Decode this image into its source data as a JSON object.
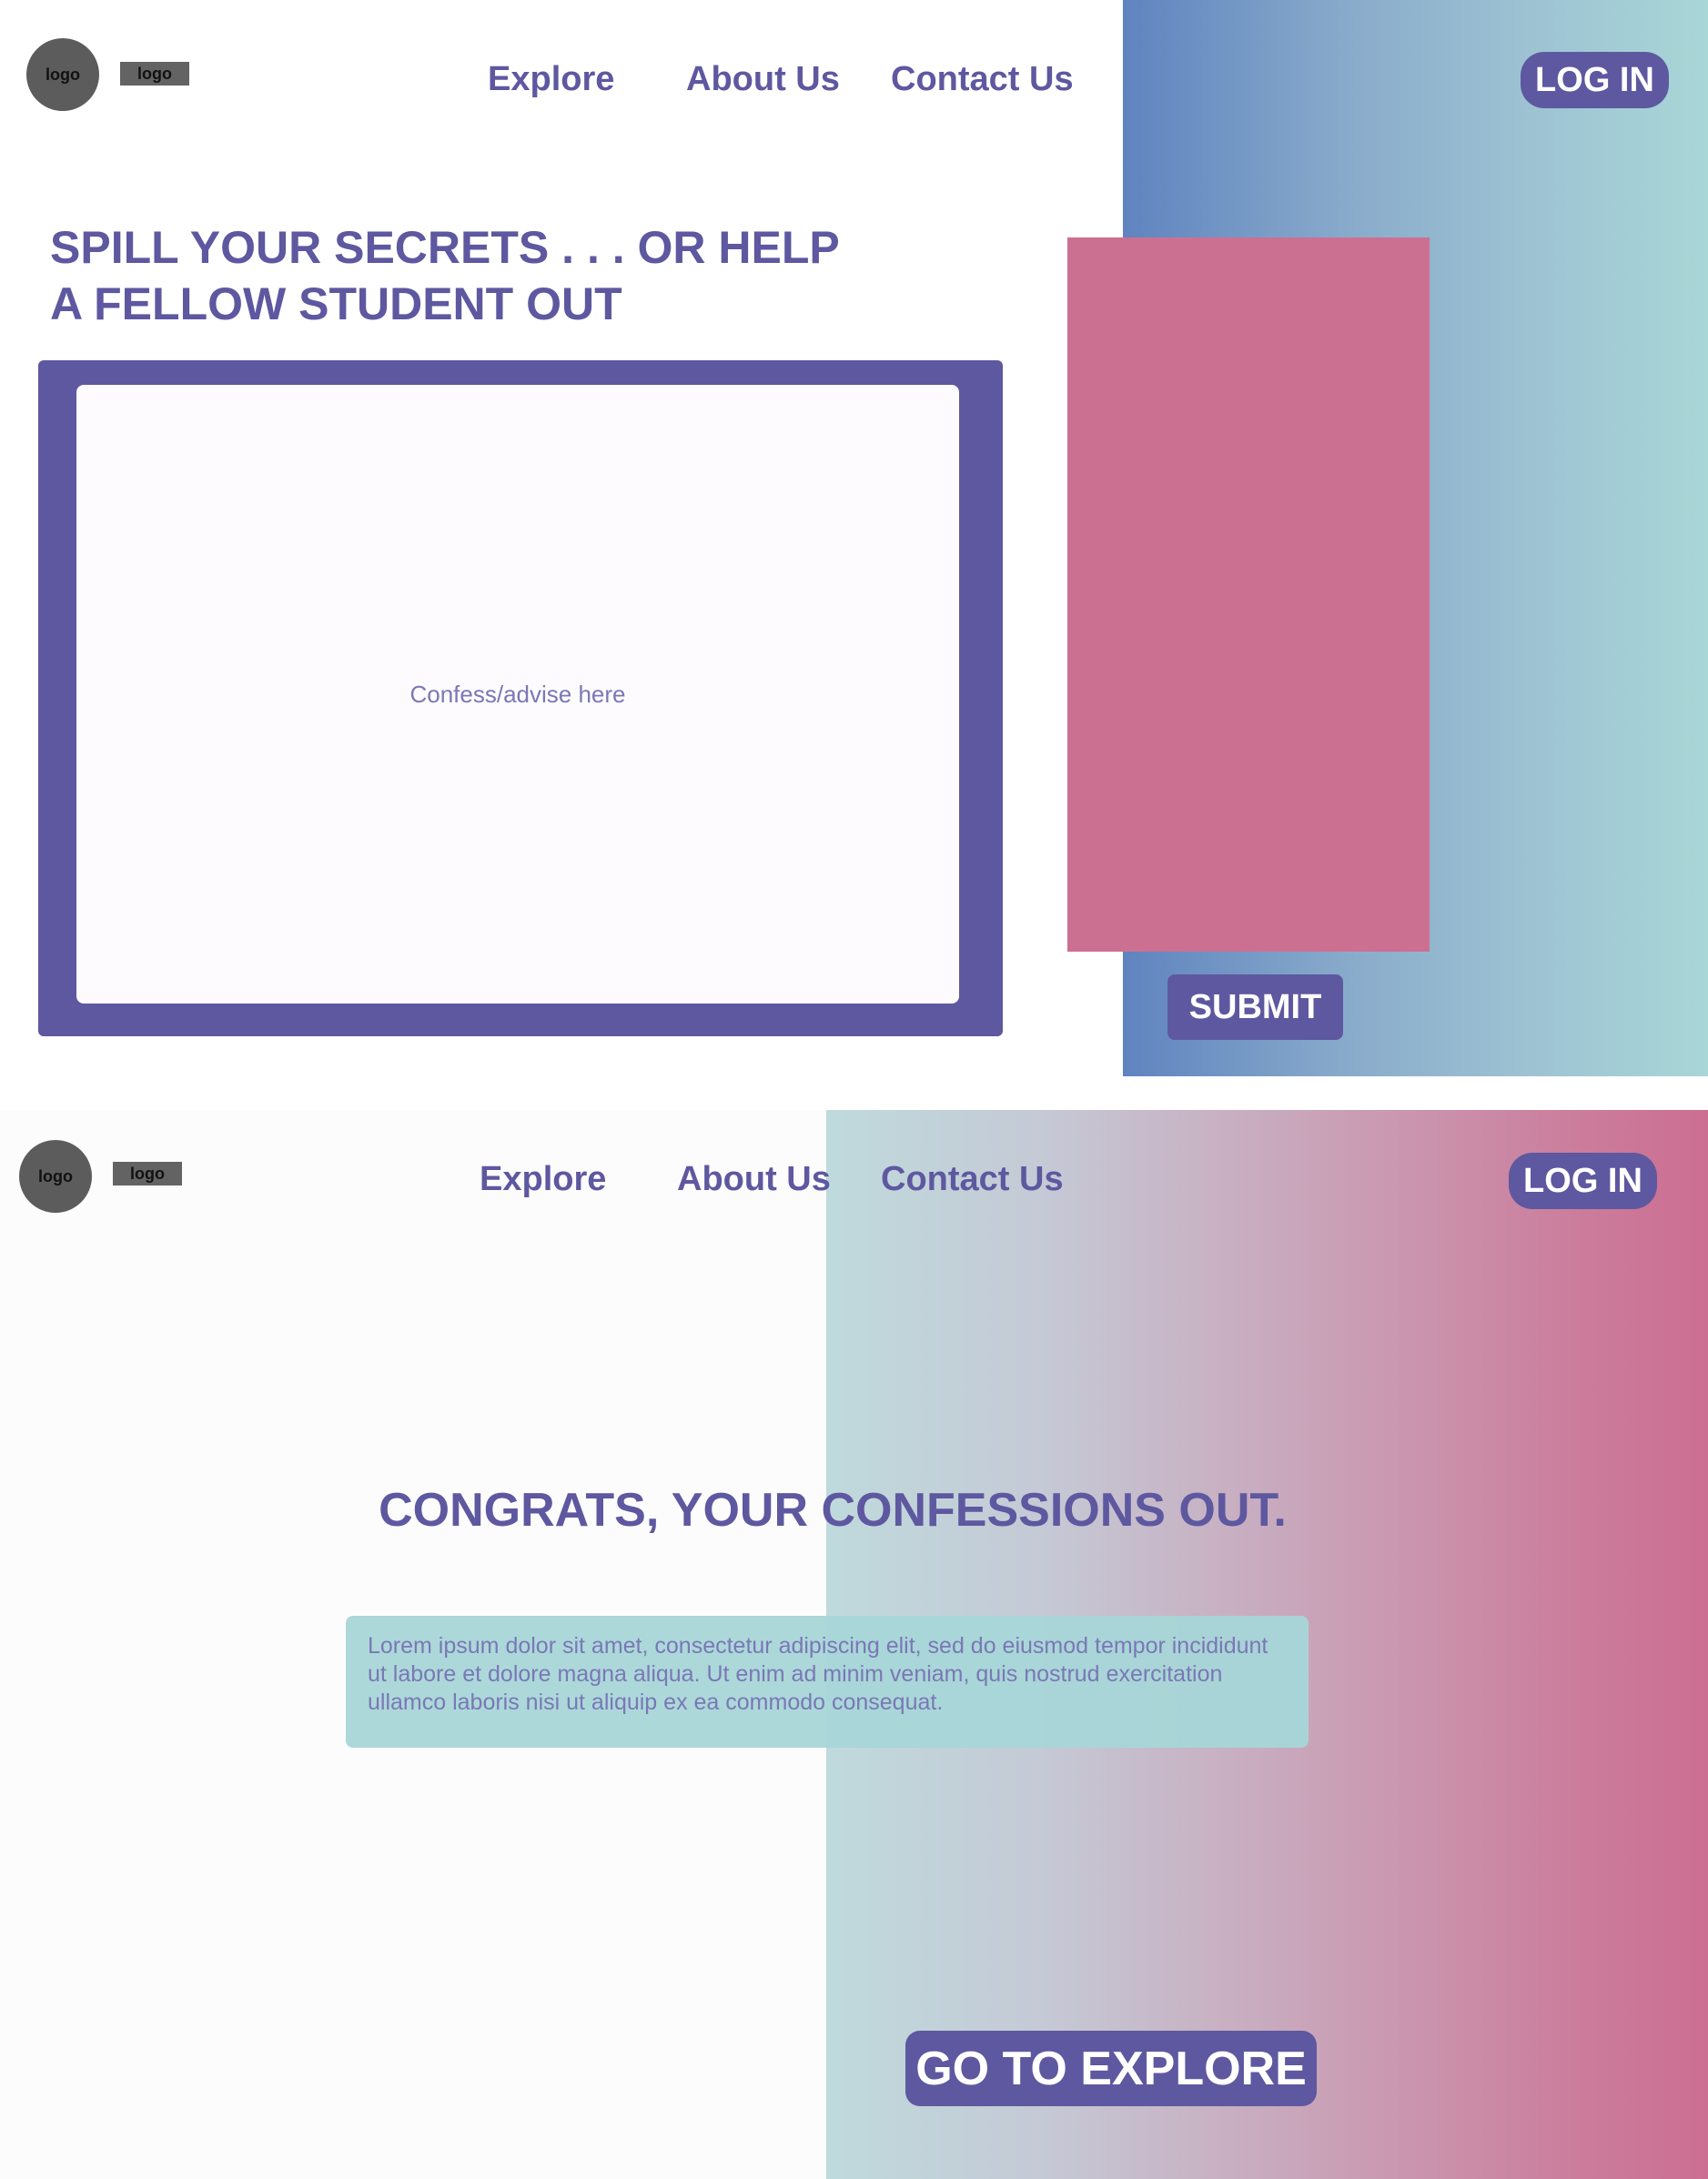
{
  "screen1": {
    "logo_circle": "logo",
    "logo_rect": "logo",
    "nav": {
      "explore": "Explore",
      "about": "About Us",
      "contact": "Contact Us",
      "login": "LOG IN"
    },
    "headline_line1": "SPILL YOUR SECRETS . . . OR HELP",
    "headline_line2": "A FELLOW STUDENT OUT",
    "textarea_placeholder": "Confess/advise  here",
    "submit_label": "SUBMIT"
  },
  "screen2": {
    "logo_circle": "logo",
    "logo_rect": "logo",
    "nav": {
      "explore": "Explore",
      "about": "About Us",
      "contact": "Contact Us",
      "login": "LOG IN"
    },
    "congrats": "CONGRATS, YOUR CONFESSIONS  OUT.",
    "lorem": "Lorem ipsum dolor sit amet, consectetur adipiscing elit, sed do eiusmod tempor incididunt ut labore et dolore magna aliqua. Ut enim ad minim veniam, quis nostrud exercitation ullamco laboris nisi ut aliquip ex ea commodo consequat.",
    "explore_button": "GO TO EXPLORE"
  },
  "colors": {
    "primary": "#5e58a0",
    "pink": "#cc7092",
    "teal": "#a9d6d7",
    "blue": "#5f84bf"
  }
}
